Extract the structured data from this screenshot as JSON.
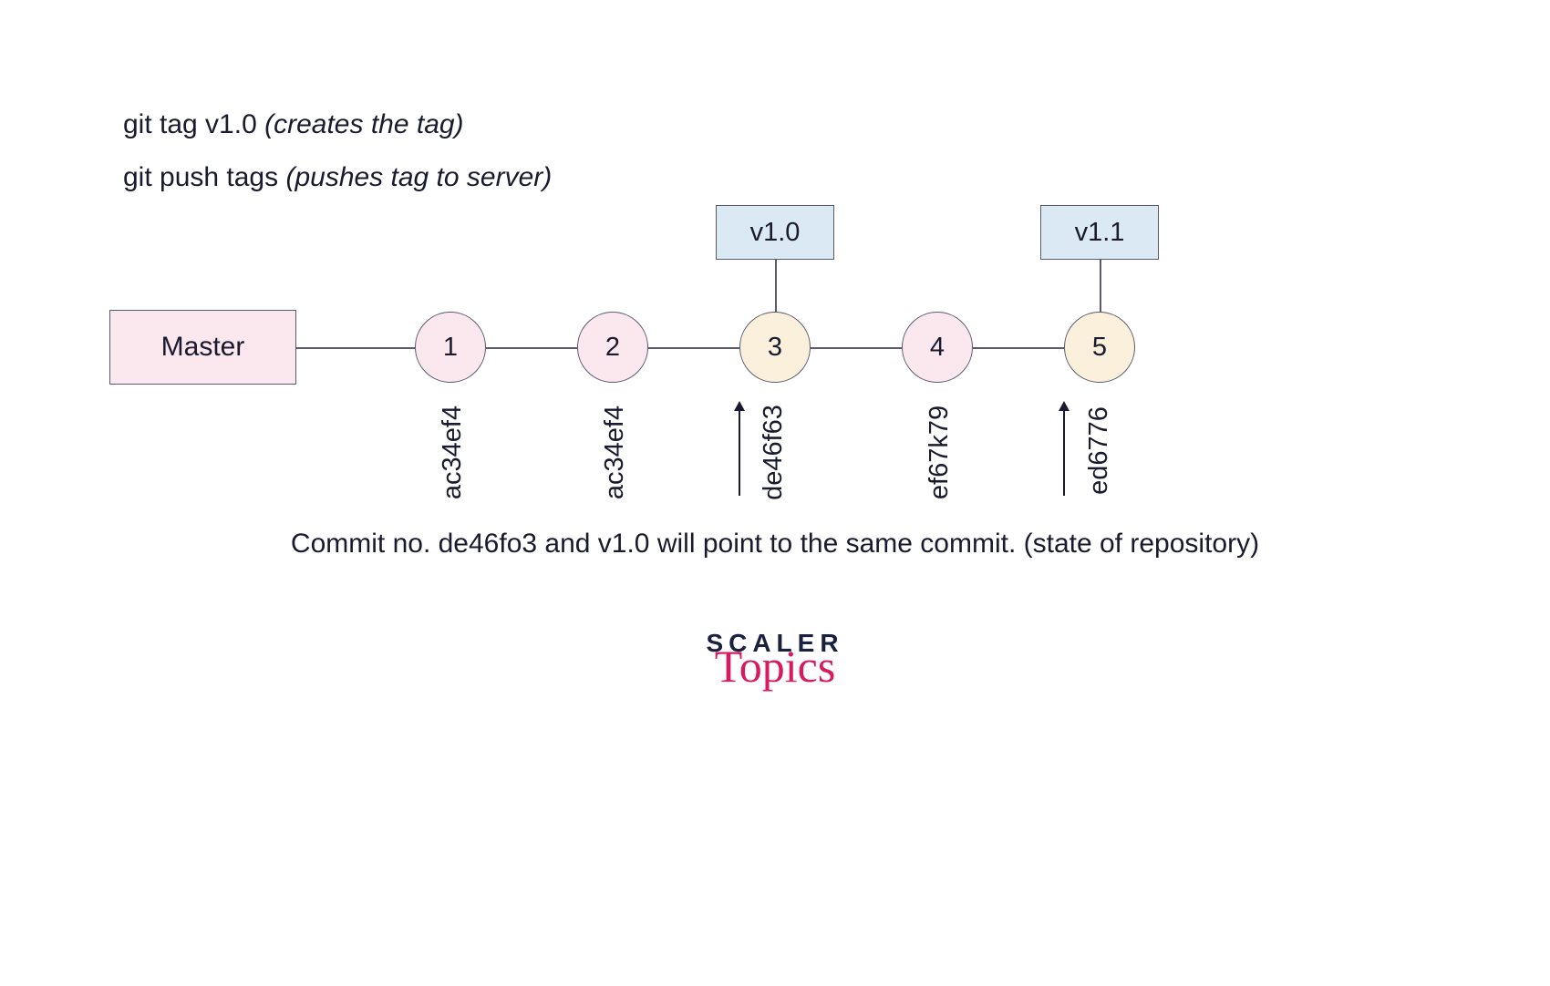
{
  "commands": [
    {
      "cmd": "git tag v1.0 ",
      "annot": "(creates the tag)"
    },
    {
      "cmd": "git push tags ",
      "annot": "(pushes tag to server)"
    }
  ],
  "branch_label": "Master",
  "tags": [
    {
      "label": "v1.0"
    },
    {
      "label": "v1.1"
    }
  ],
  "commits": [
    {
      "num": "1",
      "hash": "ac34ef4",
      "tagged": false,
      "arrow": false
    },
    {
      "num": "2",
      "hash": "ac34ef4",
      "tagged": false,
      "arrow": false
    },
    {
      "num": "3",
      "hash": "de46f63",
      "tagged": true,
      "arrow": true
    },
    {
      "num": "4",
      "hash": "ef67k79",
      "tagged": false,
      "arrow": false
    },
    {
      "num": "5",
      "hash": "ed6776",
      "tagged": true,
      "arrow": true
    }
  ],
  "caption": "Commit no. de46fo3 and v1.0 will point to the same commit. (state of repository)",
  "logo_top": "SCALER",
  "logo_bottom": "Topics"
}
